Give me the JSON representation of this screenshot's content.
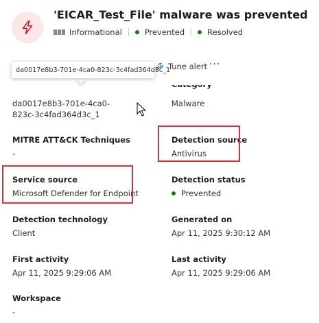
{
  "header": {
    "title": "'EICAR_Test_File' malware was prevented",
    "severity": "Informational",
    "detection_state": "Prevented",
    "resolution_state": "Resolved"
  },
  "toolbar": {
    "tooltip_text": "da0017e8b3-701e-4ca0-823c-3c4fad364d3c_1",
    "tune_alert_label": "Tune alert",
    "more_label": "···"
  },
  "details": {
    "alert_id": "da0017e8b3-701e-4ca0-823c-3c4fad364d3c_1",
    "category_value": "Malware",
    "mitre_label": "MITRE ATT&CK Techniques",
    "mitre_value": "-",
    "detection_source_label": "Detection source",
    "detection_source_value": "Antivirus",
    "service_source_label": "Service source",
    "service_source_value": "Microsoft Defender for Endpoint",
    "detection_status_label": "Detection status",
    "detection_status_value": "Prevented",
    "detection_technology_label": "Detection technology",
    "detection_technology_value": "Client",
    "generated_on_label": "Generated on",
    "generated_on_value": "Apr 11, 2025 9:30:12 AM",
    "first_activity_label": "First activity",
    "first_activity_value": "Apr 11, 2025 9:29:06 AM",
    "last_activity_label": "Last activity",
    "last_activity_value": "Apr 11, 2025 9:29:06 AM",
    "workspace_label": "Workspace",
    "workspace_value": "-"
  },
  "colors": {
    "alert_icon_bg": "#fbe6e8",
    "alert_icon_stroke": "#c50f1f",
    "status_green": "#107c10",
    "highlight_red": "#d13438"
  },
  "icons": {
    "alert": "lightning-bolt-icon",
    "tune": "wrench-icon",
    "cursor": "mouse-pointer-icon"
  }
}
